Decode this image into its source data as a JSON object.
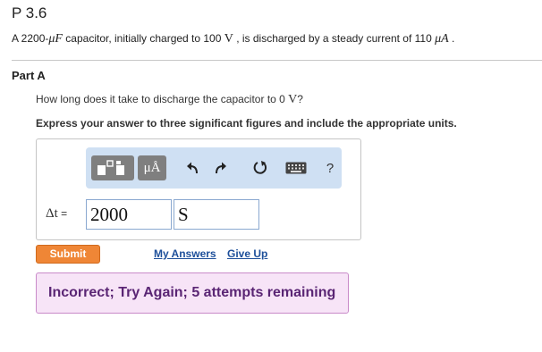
{
  "problem": {
    "title": "P 3.6",
    "text_prefix": "A 2200-",
    "capacitance_unit": "μF",
    "text_middle": " capacitor, initially charged to 100 ",
    "voltage_unit": "V",
    "text_after_voltage": " , is discharged by a steady current of 110 ",
    "current_unit": "μA",
    "text_end": " ."
  },
  "part": {
    "label": "Part A",
    "question_prefix": "How long does it take to discharge the capacitor to 0 ",
    "question_unit": "V",
    "question_suffix": "?",
    "instructions": "Express your answer to three significant figures and include the appropriate units."
  },
  "toolbar": {
    "units_button_label": "μÅ",
    "help_label": "?",
    "icons": [
      "templates-icon",
      "units-icon",
      "undo-icon",
      "redo-icon",
      "reset-icon",
      "keyboard-icon",
      "help-icon"
    ]
  },
  "answer": {
    "variable_label": "Δt",
    "equals": " = ",
    "value": "2000",
    "units": "S"
  },
  "actions": {
    "submit_label": "Submit",
    "my_answers_label": "My Answers",
    "give_up_label": "Give Up"
  },
  "feedback": {
    "message": "Incorrect; Try Again; 5 attempts remaining"
  },
  "colors": {
    "toolbar_bg": "#cfe0f3",
    "submit_bg": "#ef8636",
    "link": "#1d4f9a",
    "feedback_bg": "#f7e4f7",
    "feedback_text": "#5a2574"
  }
}
